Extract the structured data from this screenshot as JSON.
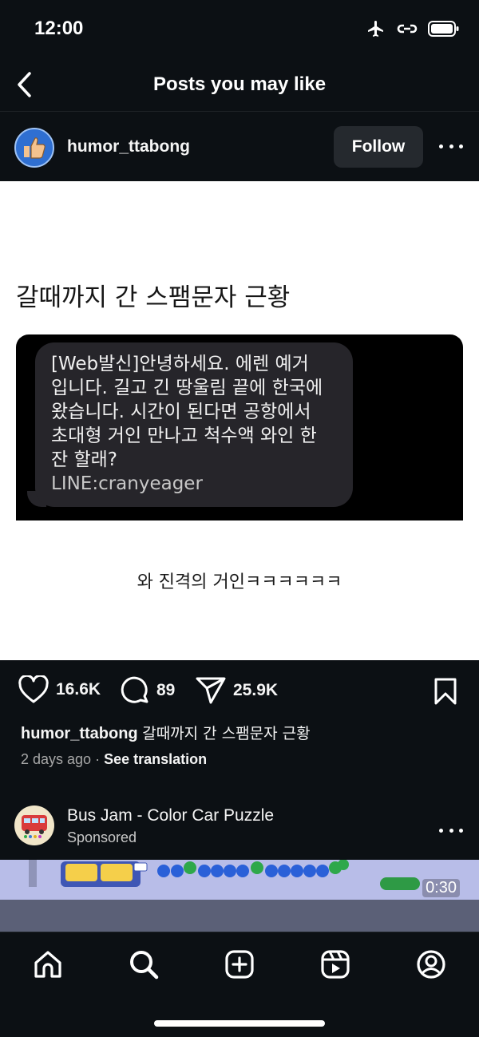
{
  "status_bar": {
    "time": "12:00",
    "icons": [
      "airplane-icon",
      "link-icon",
      "battery-icon"
    ]
  },
  "nav": {
    "back_icon": "chevron-left-icon",
    "title": "Posts you may like"
  },
  "post": {
    "username": "humor_ttabong",
    "follow_label": "Follow",
    "more_icon": "more-horizontal-icon",
    "image": {
      "title": "갈때까지 간 스팸문자 근황",
      "sms_lines": [
        "[Web발신]안녕하세요. 에렌 예거",
        "입니다. 길고 긴 땅울림 끝에 한국에",
        "왔습니다. 시간이 된다면 공항에서",
        "초대형 거인 만나고 척수액 와인 한",
        "잔 할래?",
        "LINE:cranyeager"
      ],
      "caption": "와 진격의 거인ㅋㅋㅋㅋㅋㅋ"
    },
    "likes": "16.6K",
    "comments": "89",
    "shares": "25.9K",
    "caption_user": "humor_ttabong",
    "caption_text": "갈때까지 간 스팸문자 근황",
    "time_ago": "2 days ago",
    "separator": "·",
    "see_translation": "See translation"
  },
  "sponsored_post": {
    "name": "Bus Jam - Color Car Puzzle",
    "label": "Sponsored",
    "video_time": "0:30"
  },
  "bottom_nav": {
    "items": [
      "home-icon",
      "search-icon",
      "create-icon",
      "reels-icon",
      "profile-icon"
    ]
  },
  "colors": {
    "background": "#0c1014",
    "button": "#25292e",
    "text": "#f5f5f5",
    "secondary_text": "#a8a8a8"
  }
}
